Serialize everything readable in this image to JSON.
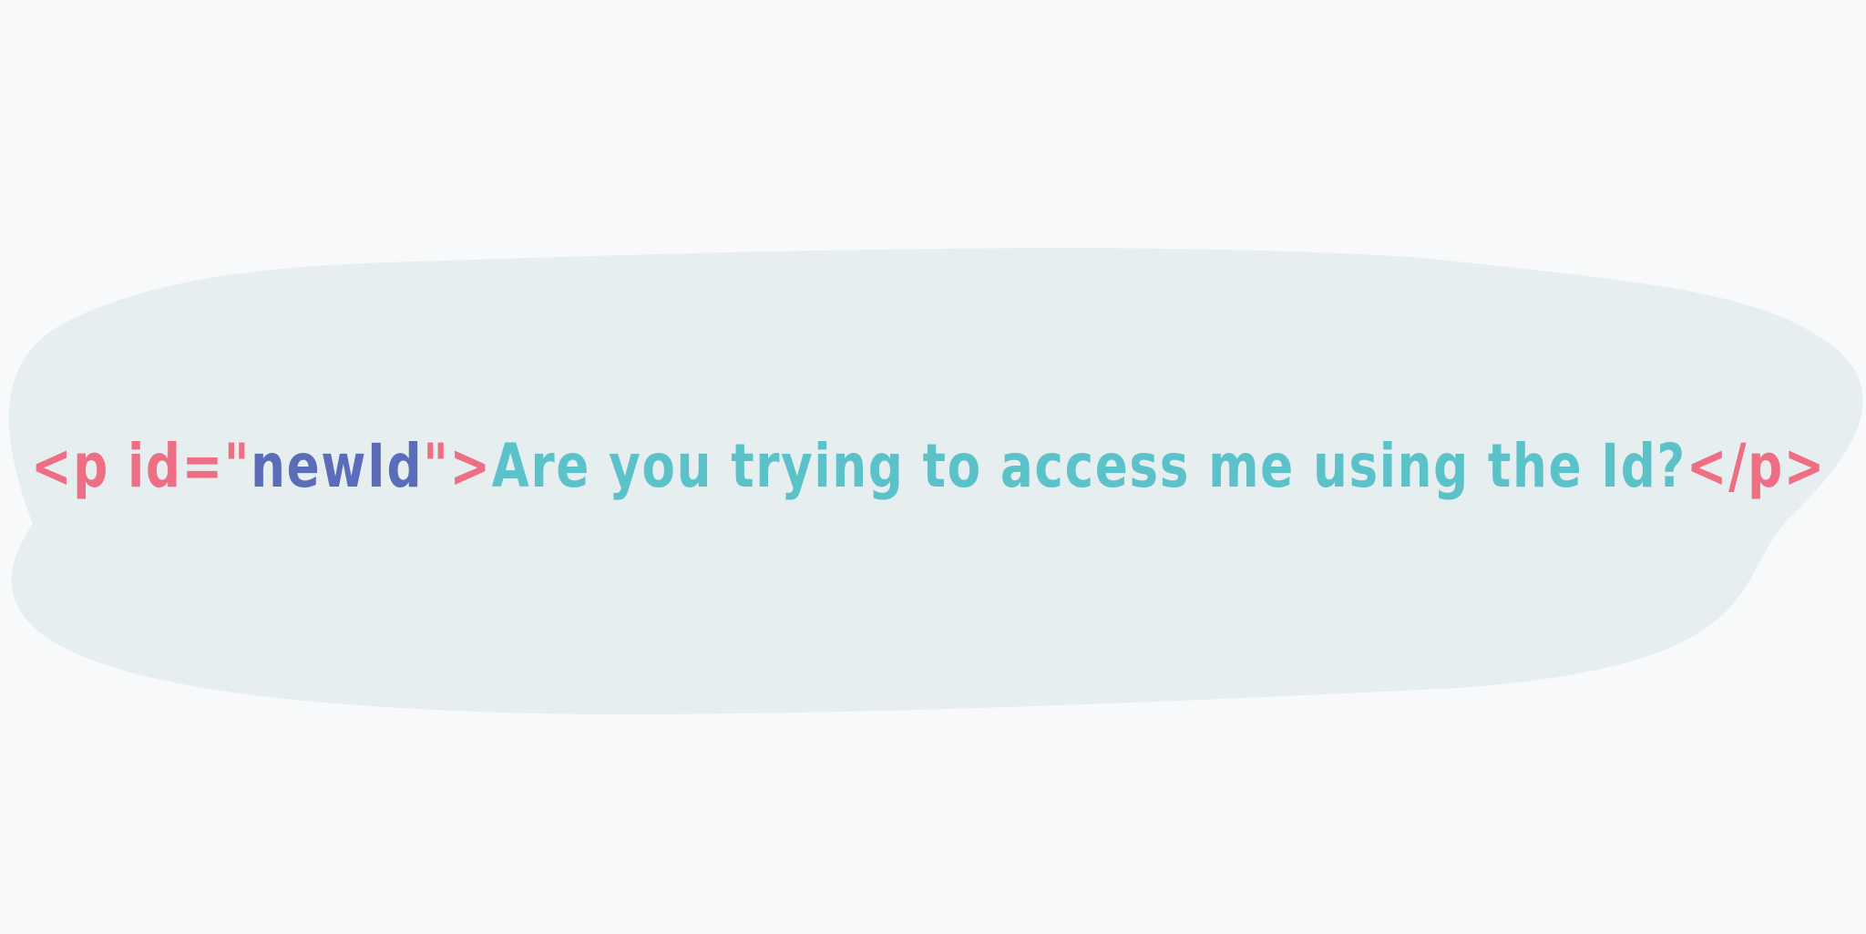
{
  "snippet": {
    "open_tag_start": "<p id=",
    "quote_open": "\"",
    "id_value": "newId",
    "quote_close": "\"",
    "open_tag_end": ">",
    "content": "Are you trying to access me using the Id?",
    "close_tag": "</p>"
  },
  "colors": {
    "background": "#f7f9fa",
    "blob": "#e6eef0",
    "tag": "#ee6f84",
    "id_value": "#5b6db8",
    "content": "#5bc2c9"
  }
}
